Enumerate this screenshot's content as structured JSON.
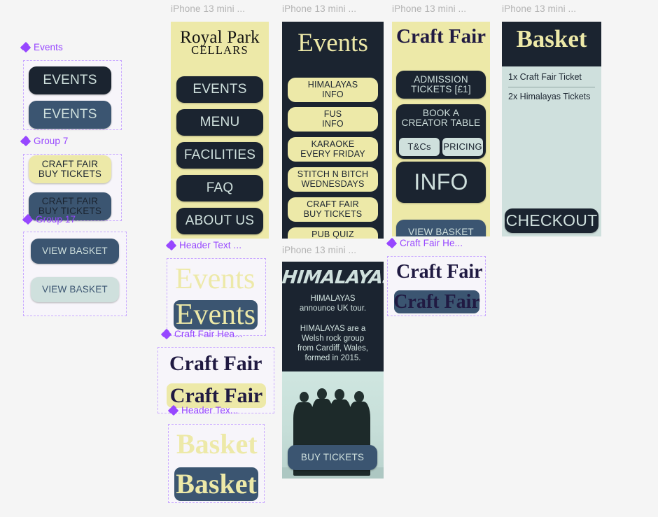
{
  "canvas": {
    "background": "#f5f5f5",
    "component_accent": "#9747ff",
    "frame_label_color": "#b3b3b3",
    "palette": {
      "dark": "#1b2430",
      "cream": "#ede9a8",
      "slate": "#3b5571",
      "mint": "#cfe0dd"
    }
  },
  "frame_labels": {
    "home": "iPhone 13 mini ...",
    "events": "iPhone 13 mini ...",
    "craft_fair": "iPhone 13 mini ...",
    "basket": "iPhone 13 mini ...",
    "himalayas": "iPhone 13 mini ..."
  },
  "component_labels": {
    "events": "Events",
    "group7": "Group 7",
    "group17": "Group 17",
    "header_text_events": "Header Text ...",
    "craft_fair_header_left": "Craft Fair Hea...",
    "header_text_basket": "Header Tex...",
    "craft_fair_header_right": "Craft Fair He..."
  },
  "components": {
    "events_buttons": [
      {
        "label": "EVENTS",
        "style": "dark"
      },
      {
        "label": "EVENTS",
        "style": "slate"
      }
    ],
    "group7_buttons": [
      {
        "label": "CRAFT FAIR\nBUY TICKETS",
        "style": "cream"
      },
      {
        "label": "CRAFT FAIR\nBUY TICKETS",
        "style": "slate-dark-text"
      }
    ],
    "group17_buttons": [
      {
        "label": "VIEW BASKET",
        "style": "slate"
      },
      {
        "label": "VIEW BASKET",
        "style": "mint"
      }
    ],
    "events_headers": [
      {
        "label": "Events",
        "style": "plain-cream"
      },
      {
        "label": "Events",
        "style": "slate-cream"
      }
    ],
    "craft_fair_headers_left": [
      {
        "label": "Craft Fair",
        "style": "plain-dark"
      },
      {
        "label": "Craft Fair",
        "style": "cream-dark"
      }
    ],
    "basket_headers": [
      {
        "label": "Basket",
        "style": "plain-cream"
      },
      {
        "label": "Basket",
        "style": "slate-cream"
      }
    ],
    "craft_fair_headers_right": [
      {
        "label": "Craft Fair",
        "style": "plain-dark"
      },
      {
        "label": "Craft Fair",
        "style": "slate-dark"
      }
    ]
  },
  "screens": {
    "home": {
      "logo_line1": "Royal Park",
      "logo_line2": "CELLARS",
      "nav": [
        "EVENTS",
        "MENU",
        "FACILITIES",
        "FAQ",
        "ABOUT US"
      ]
    },
    "events": {
      "title": "Events",
      "items": [
        "HIMALAYAS\nINFO",
        "FUS\nINFO",
        "KARAOKE\nEVERY FRIDAY",
        "STITCH N BITCH\nWEDNESDAYS",
        "CRAFT FAIR\nBUY TICKETS",
        "PUB QUIZ\nTUESDAYS"
      ]
    },
    "craft_fair": {
      "title": "Craft Fair",
      "admission": "ADMISSION\nTICKETS [£1]",
      "book_table": "BOOK A\nCREATOR TABLE",
      "tcs": "T&Cs",
      "pricing": "PRICING",
      "info": "INFO",
      "view_basket": "VIEW BASKET"
    },
    "basket": {
      "title": "Basket",
      "items": [
        "1x Craft Fair Ticket",
        "2x Himalayas Tickets"
      ],
      "checkout": "CHECKOUT"
    },
    "himalayas": {
      "logo": "HIMALAYAS",
      "headline": "HIMALAYAS\nannounce UK tour.",
      "body": "HIMALAYAS are a\nWelsh rock group\nfrom Cardiff, Wales,\nformed in 2015.",
      "buy_tickets": "BUY TICKETS"
    }
  }
}
